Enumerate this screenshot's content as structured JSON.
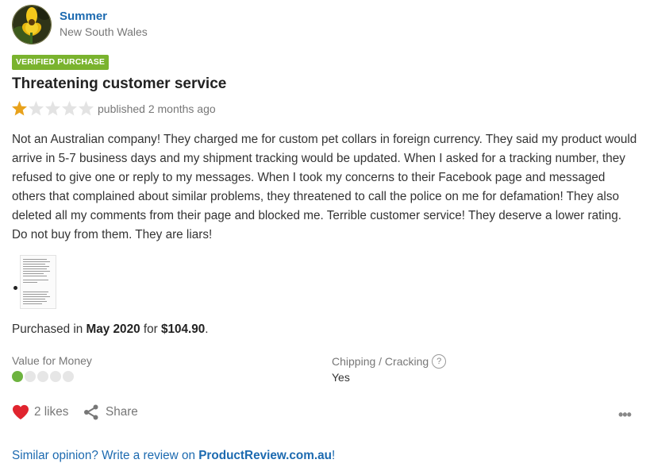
{
  "author": {
    "name": "Summer",
    "location": "New South Wales",
    "avatar_icon": "yellow-flower-avatar"
  },
  "review": {
    "badge": "VERIFIED PURCHASE",
    "title": "Threatening customer service",
    "rating": 1,
    "rating_max": 5,
    "published": "published 2 months ago",
    "body": "Not an Australian company! They charged me for custom pet collars in foreign currency. They said my product would arrive in 5-7 business days and my shipment tracking would be updated. When I asked for a tracking number, they refused to give one or reply to my messages. When I took my concerns to their Facebook page and messaged others that complained about similar problems, they threatened to call the police on me for defamation! They also deleted all my comments from their page and blocked me. Terrible customer service! They deserve a lower rating. Do not buy from them. They are liars!"
  },
  "purchase": {
    "prefix": "Purchased in",
    "date": "May 2020",
    "for": "for",
    "price": "$104.90",
    "suffix": "."
  },
  "attributes": {
    "value_for_money": {
      "label": "Value for Money",
      "score": 1,
      "max": 5
    },
    "chipping": {
      "label": "Chipping / Cracking",
      "help": "?",
      "value": "Yes"
    }
  },
  "actions": {
    "likes": "2 likes",
    "share": "Share",
    "more": "•••"
  },
  "cta": {
    "text": "Similar opinion? Write a review on",
    "link": "ProductReview.com.au",
    "suffix": "!"
  },
  "colors": {
    "accent_blue": "#1c6ab0",
    "badge_green": "#7ab32e",
    "star_gold": "#e8a21c",
    "heart_red": "#e0242e",
    "dot_green": "#6db33f"
  }
}
